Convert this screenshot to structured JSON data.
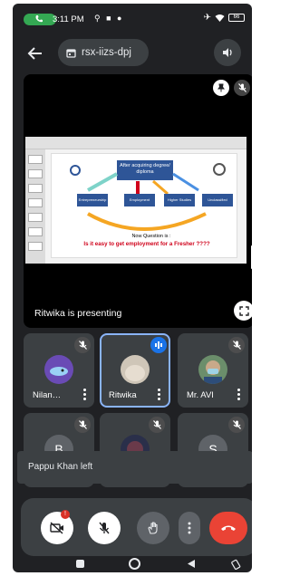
{
  "status_bar": {
    "time": "3:11 PM",
    "battery": "66"
  },
  "app_bar": {
    "meeting_code": "rsx-iizs-dpj"
  },
  "presentation": {
    "presenter_label": "Ritwika is presenting",
    "slide": {
      "title": "After acquiring degree/ diploma",
      "boxes": [
        "Entrepreneurship",
        "Employment",
        "Higher Studies",
        "Unclassified Avenue"
      ],
      "question_line1": "Now Question is :",
      "question_line2": "Is it easy to get employment for a Fresher ????"
    }
  },
  "participants": [
    {
      "name": "Nilan…",
      "muted": true,
      "avatar": "fish-photo"
    },
    {
      "name": "Ritwika",
      "muted": false,
      "speaking": true,
      "avatar": "photo"
    },
    {
      "name": "Mr. AVI",
      "muted": true,
      "avatar": "masked-photo"
    },
    {
      "name": "",
      "initial": "B",
      "muted": true
    },
    {
      "name": "",
      "initial": "",
      "muted": true,
      "avatar": "dark-photo"
    },
    {
      "name": "",
      "initial": "S",
      "muted": true
    }
  ],
  "toast": {
    "message": "Pappu Khan left"
  },
  "controls": {
    "camera_badge": "!"
  },
  "colors": {
    "background": "#202124",
    "tile": "#3c4043",
    "accent_blue": "#8ab4f8",
    "end_call_red": "#ea4335",
    "call_green": "#34a853"
  }
}
